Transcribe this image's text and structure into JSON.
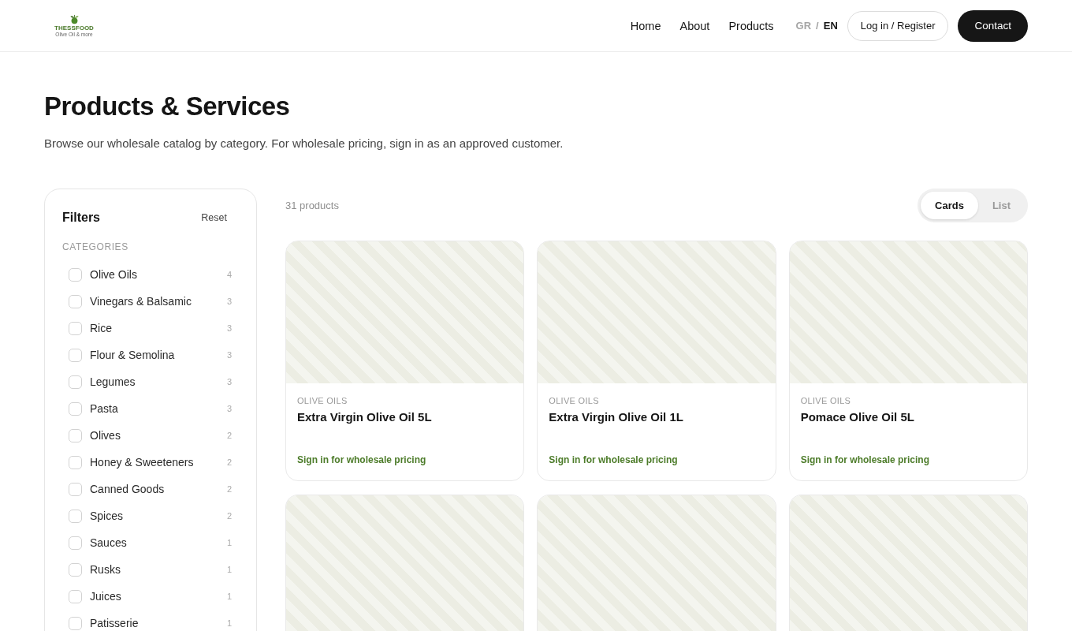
{
  "header": {
    "logo": {
      "wordmark": "THESSFOOD",
      "tagline": "Olive Oil & more"
    },
    "nav": [
      "Home",
      "About",
      "Products"
    ],
    "languages": [
      {
        "label": "GR",
        "selected": false
      },
      {
        "label": "EN",
        "selected": true
      }
    ],
    "language_separator": "/",
    "login_button": "Log in / Register",
    "contact_button": "Contact"
  },
  "intro": {
    "title": "Products & Services",
    "text": "Browse our wholesale catalog by category. For wholesale pricing, sign in as an approved customer."
  },
  "filters": {
    "title": "Filters",
    "reset": "Reset",
    "section": "CATEGORIES",
    "categories": [
      {
        "label": "Olive Oils",
        "count": "4",
        "checked": false
      },
      {
        "label": "Vinegars & Balsamic",
        "count": "3",
        "checked": false
      },
      {
        "label": "Rice",
        "count": "3",
        "checked": false
      },
      {
        "label": "Flour & Semolina",
        "count": "3",
        "checked": false
      },
      {
        "label": "Legumes",
        "count": "3",
        "checked": false
      },
      {
        "label": "Pasta",
        "count": "3",
        "checked": false
      },
      {
        "label": "Olives",
        "count": "2",
        "checked": false
      },
      {
        "label": "Honey & Sweeteners",
        "count": "2",
        "checked": false
      },
      {
        "label": "Canned Goods",
        "count": "2",
        "checked": false
      },
      {
        "label": "Spices",
        "count": "2",
        "checked": false
      },
      {
        "label": "Sauces",
        "count": "1",
        "checked": false
      },
      {
        "label": "Rusks",
        "count": "1",
        "checked": false
      },
      {
        "label": "Juices",
        "count": "1",
        "checked": false
      },
      {
        "label": "Patisserie",
        "count": "1",
        "checked": false
      }
    ]
  },
  "results": {
    "count": "31 products",
    "views": [
      {
        "label": "Cards",
        "selected": true
      },
      {
        "label": "List",
        "selected": false
      }
    ],
    "products": [
      {
        "kind": "card",
        "category": "OLIVE OILS",
        "name": "Extra Virgin Olive Oil 5L",
        "pricing": "Sign in for wholesale pricing"
      },
      {
        "kind": "card",
        "category": "OLIVE OILS",
        "name": "Extra Virgin Olive Oil 1L",
        "pricing": "Sign in for wholesale pricing"
      },
      {
        "kind": "card",
        "category": "OLIVE OILS",
        "name": "Pomace Olive Oil 5L",
        "pricing": "Sign in for wholesale pricing"
      },
      {
        "kind": "image_only"
      },
      {
        "kind": "image_only"
      },
      {
        "kind": "image_only"
      }
    ]
  }
}
